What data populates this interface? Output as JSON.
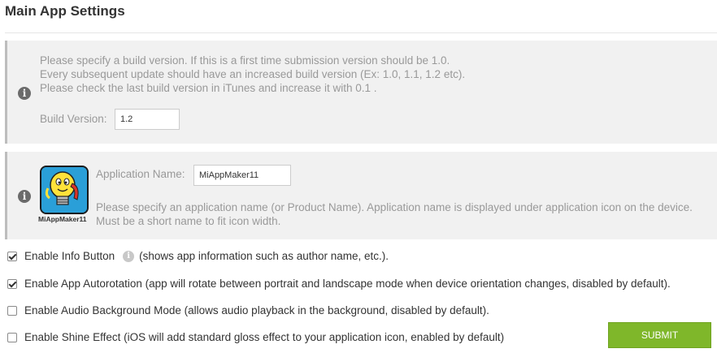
{
  "header": {
    "title": "Main App Settings"
  },
  "build_panel": {
    "info_lines": [
      "Please specify a build version. If this is a first time submission version should be 1.0.",
      "Every subsequent update should have an increased build version (Ex: 1.0, 1.1, 1.2 etc).",
      "Please check the last build version in iTunes and increase it with 0.1 ."
    ],
    "label": "Build Version:",
    "value": "1.2"
  },
  "app_panel": {
    "icon_caption": "MiAppMaker11",
    "label": "Application Name:",
    "value": "MiAppMaker11",
    "description": "Please specify an application name (or Product Name). Application name is displayed under application icon on the device. Must be a short name to fit icon width."
  },
  "options": {
    "info_button": {
      "label": "Enable Info Button",
      "hint": "(shows app information such as author name, etc.).",
      "checked": true
    },
    "autorotation": {
      "label": "Enable App Autorotation (app will rotate between portrait and landscape mode when device orientation changes, disabled by default).",
      "checked": true
    },
    "audio_background": {
      "label": "Enable Audio Background Mode (allows audio playback in the background, disabled by default).",
      "checked": false
    },
    "shine_effect": {
      "label": "Enable Shine Effect (iOS will add standard gloss effect to your application icon, enabled by default)",
      "checked": false
    }
  },
  "submit": {
    "label": "SUBMIT"
  },
  "icons": {
    "panel_info": "info-icon",
    "app_icon": "lightbulb-phone-mascot-icon",
    "inline_info": "info-icon"
  },
  "colors": {
    "panel_background": "#f1f1f1",
    "panel_border": "#bdbdbd",
    "submit_background": "#7fb72a",
    "muted_text": "#999999"
  }
}
